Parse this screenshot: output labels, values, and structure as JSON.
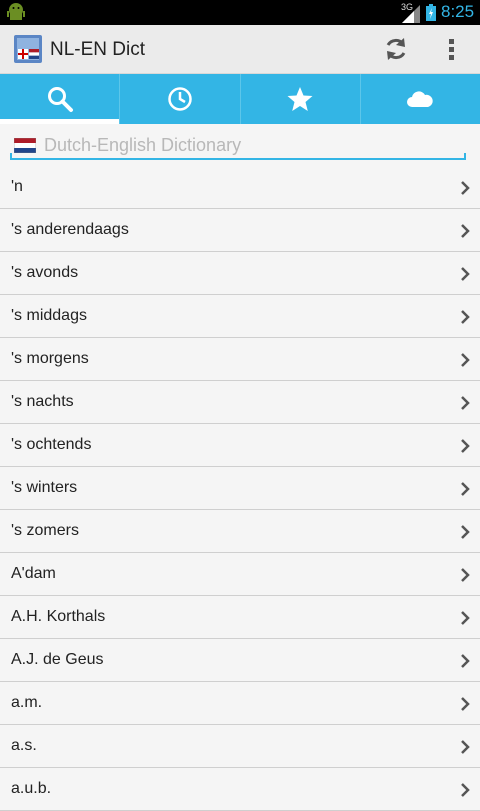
{
  "status_bar": {
    "network": "3G",
    "time": "8:25"
  },
  "action_bar": {
    "title": "NL-EN Dict",
    "refresh_icon": "refresh-icon",
    "overflow_icon": "overflow-menu-icon"
  },
  "tabs": [
    {
      "icon": "search-icon",
      "active": true
    },
    {
      "icon": "history-icon",
      "active": false
    },
    {
      "icon": "star-icon",
      "active": false
    },
    {
      "icon": "cloud-icon",
      "active": false
    }
  ],
  "search": {
    "placeholder": "Dutch-English Dictionary",
    "value": ""
  },
  "words": [
    "'n",
    "'s anderendaags",
    "'s avonds",
    "'s middags",
    "'s morgens",
    "'s nachts",
    "'s ochtends",
    "'s winters",
    "'s zomers",
    "A'dam",
    "A.H. Korthals",
    "A.J. de Geus",
    "a.m.",
    "a.s.",
    "a.u.b."
  ],
  "colors": {
    "accent": "#33b5e5",
    "action_bar": "#ebebeb",
    "background": "#f5f5f5"
  }
}
